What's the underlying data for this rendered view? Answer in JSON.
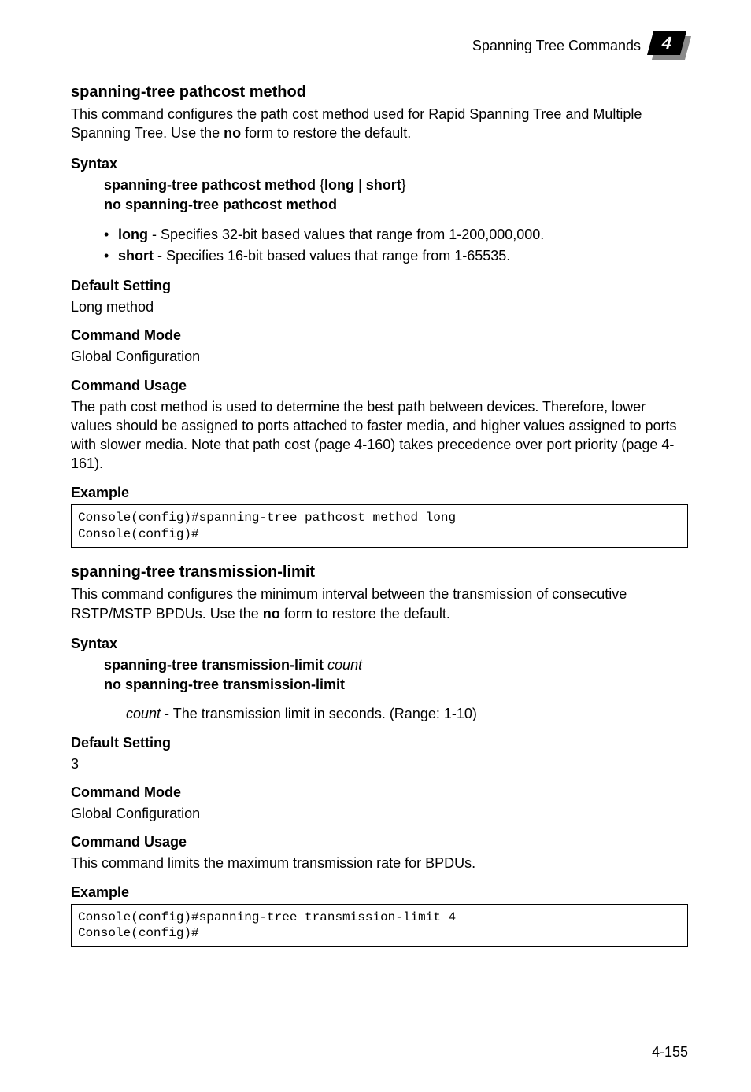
{
  "header": {
    "section_title": "Spanning Tree Commands",
    "icon_number": "4"
  },
  "section1": {
    "title": "spanning-tree pathcost method",
    "intro_pre": "This command configures the path cost method used for Rapid Spanning Tree and Multiple Spanning Tree. Use the ",
    "intro_bold": "no",
    "intro_post": " form to restore the default.",
    "syntax_label": "Syntax",
    "syntax_cmd_b1": "spanning-tree pathcost method",
    "syntax_brace_open": " {",
    "syntax_opt1": "long",
    "syntax_pipe": " | ",
    "syntax_opt2": "short",
    "syntax_brace_close": "}",
    "syntax_cmd2": "no spanning-tree pathcost method",
    "bullet1_b": "long",
    "bullet1_t": " - Specifies 32-bit based values that range from 1-200,000,000.",
    "bullet2_b": "short",
    "bullet2_t": " - Specifies 16-bit based values that range from 1-65535.",
    "default_label": "Default Setting",
    "default_value": "Long method",
    "mode_label": "Command Mode",
    "mode_value": "Global Configuration",
    "usage_label": "Command Usage",
    "usage_text": "The path cost method is used to determine the best path between devices. Therefore, lower values should be assigned to ports attached to faster media, and higher values assigned to ports with slower media. Note that path cost (page 4-160) takes precedence over port priority (page 4-161).",
    "example_label": "Example",
    "console": "Console(config)#spanning-tree pathcost method long\nConsole(config)#"
  },
  "section2": {
    "title": "spanning-tree transmission-limit",
    "intro_pre": "This command configures the minimum interval between the transmission of consecutive RSTP/MSTP BPDUs. Use the ",
    "intro_bold": "no",
    "intro_post": " form to restore the default.",
    "syntax_label": "Syntax",
    "syntax_cmd_b1": "spanning-tree transmission-limit",
    "syntax_cmd_i1": " count",
    "syntax_cmd2": "no spanning-tree transmission-limit",
    "param_i": "count",
    "param_t": " - The transmission limit in seconds. (Range: 1-10)",
    "default_label": "Default Setting",
    "default_value": "3",
    "mode_label": "Command Mode",
    "mode_value": "Global Configuration",
    "usage_label": "Command Usage",
    "usage_text": "This command limits the maximum transmission rate for BPDUs.",
    "example_label": "Example",
    "console": "Console(config)#spanning-tree transmission-limit 4\nConsole(config)#"
  },
  "page_number": "4-155"
}
